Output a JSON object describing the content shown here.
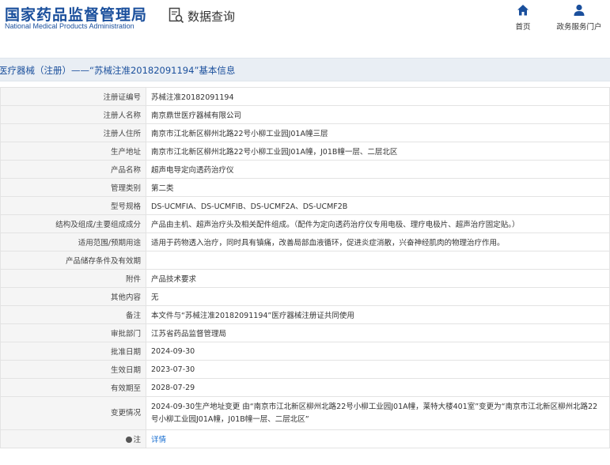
{
  "header": {
    "logo_cn": "国家药品监督管理局",
    "logo_en": "National Medical Products Administration",
    "search_title": "数据查询",
    "nav": {
      "home": "首页",
      "portal": "政务服务门户"
    }
  },
  "title_bar": "医疗器械（注册）——“苏械注准20182091194”基本信息",
  "rows": [
    {
      "label": "注册证编号",
      "value": "苏械注准20182091194"
    },
    {
      "label": "注册人名称",
      "value": "南京鼎世医疗器械有限公司"
    },
    {
      "label": "注册人住所",
      "value": "南京市江北新区柳州北路22号小柳工业园J01A幢三层"
    },
    {
      "label": "生产地址",
      "value": "南京市江北新区柳州北路22号小柳工业园J01A幢，J01B幢一层、二层北区"
    },
    {
      "label": "产品名称",
      "value": "超声电导定向透药治疗仪"
    },
    {
      "label": "管理类别",
      "value": "第二类"
    },
    {
      "label": "型号规格",
      "value": "DS-UCMFIA、DS-UCMFIB、DS-UCMF2A、DS-UCMF2B"
    },
    {
      "label": "结构及组成/主要组成成分",
      "value": "产品由主机、超声治疗头及相关配件组成。（配件为定向透药治疗仪专用电极、理疗电极片、超声治疗固定贴。）"
    },
    {
      "label": "适用范围/预期用途",
      "value": "适用于药物透入治疗，同时具有镇痛，改善局部血液循环，促进炎症消散，兴奋神经肌肉的物理治疗作用。"
    },
    {
      "label": "产品储存条件及有效期",
      "value": ""
    },
    {
      "label": "附件",
      "value": "产品技术要求"
    },
    {
      "label": "其他内容",
      "value": "无"
    },
    {
      "label": "备注",
      "value": "本文件与“苏械注准20182091194”医疗器械注册证共同使用"
    },
    {
      "label": "审批部门",
      "value": "江苏省药品监督管理局"
    },
    {
      "label": "批准日期",
      "value": "2024-09-30"
    },
    {
      "label": "生效日期",
      "value": "2023-07-30"
    },
    {
      "label": "有效期至",
      "value": "2028-07-29"
    },
    {
      "label": "变更情况",
      "value": "2024-09-30生产地址变更 由“南京市江北新区柳州北路22号小柳工业园J01A幢，莱特大楼401室”变更为“南京市江北新区柳州北路22号小柳工业园J01A幢，J01B幢一层、二层北区”"
    }
  ],
  "note_row": {
    "label": "注",
    "value": "详情"
  },
  "icons": {
    "home": "home-icon",
    "portal": "user-icon",
    "search": "search-document-icon",
    "note": "info-icon"
  },
  "colors": {
    "brand": "#1a4f9c",
    "link": "#1a6fd1",
    "label_bg": "#f5f5f5",
    "title_bar_bg": "#e9eef4"
  }
}
